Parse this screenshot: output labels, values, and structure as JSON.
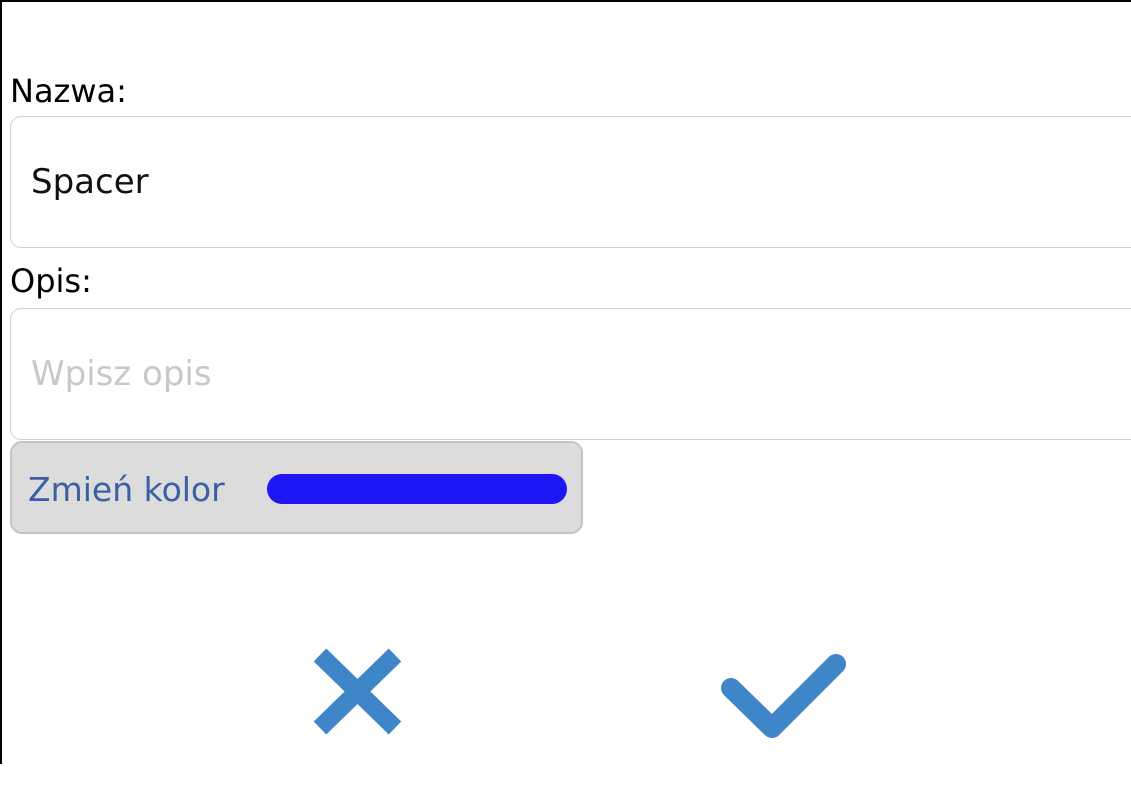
{
  "form": {
    "name_label": "Nazwa:",
    "name_value": "Spacer",
    "description_label": "Opis:",
    "description_placeholder": "Wpisz opis",
    "description_value": "",
    "change_color_label": "Zmień kolor"
  },
  "colors": {
    "selected_color": "#1f16f5",
    "accent": "#3f86c8",
    "button_text": "#3a5fa3"
  },
  "actions": {
    "cancel_icon": "close-icon",
    "confirm_icon": "checkmark-icon"
  }
}
